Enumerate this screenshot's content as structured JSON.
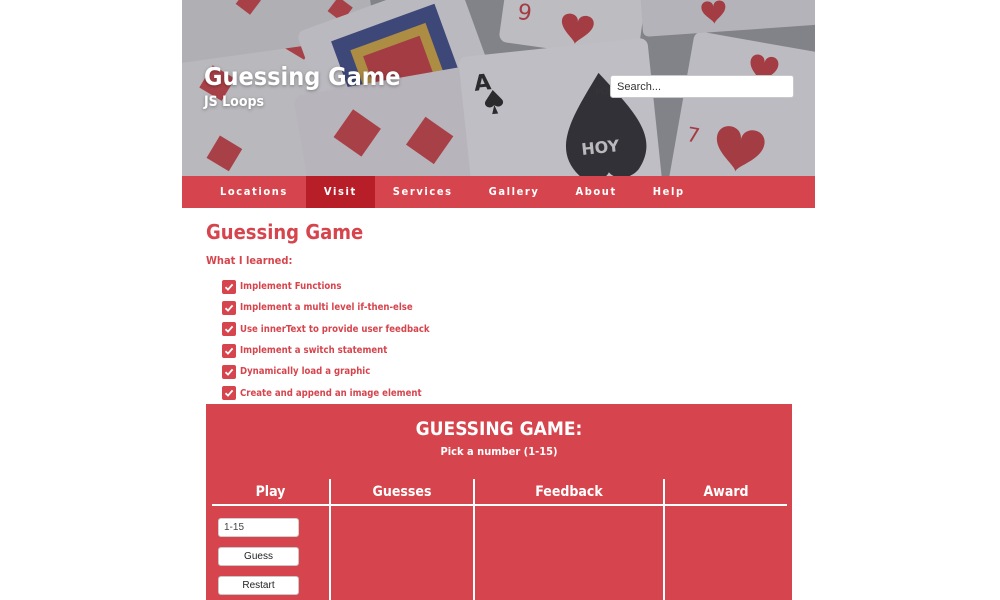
{
  "header": {
    "title": "Guessing Game",
    "subtitle": "JS Loops",
    "search_placeholder": "Search..."
  },
  "nav": {
    "items": [
      "Locations",
      "Visit",
      "Services",
      "Gallery",
      "About",
      "Help"
    ],
    "active": "Visit"
  },
  "main": {
    "heading": "Guessing Game",
    "learned_label": "What I learned:",
    "learned_items": [
      "Implement Functions",
      "Implement a multi level if-then-else",
      "Use innerText to provide user feedback",
      "Implement a switch statement",
      "Dynamically load a graphic",
      "Create and append an image element"
    ]
  },
  "game": {
    "title": "GUESSING GAME:",
    "subtitle": "Pick a number (1-15)",
    "columns": [
      "Play",
      "Guesses",
      "Feedback",
      "Award"
    ],
    "input_placeholder": "1-15",
    "guess_label": "Guess",
    "restart_label": "Restart"
  },
  "colors": {
    "accent": "#d6454d",
    "nav_active": "#b81e28",
    "text_on_accent": "#ffffff"
  }
}
